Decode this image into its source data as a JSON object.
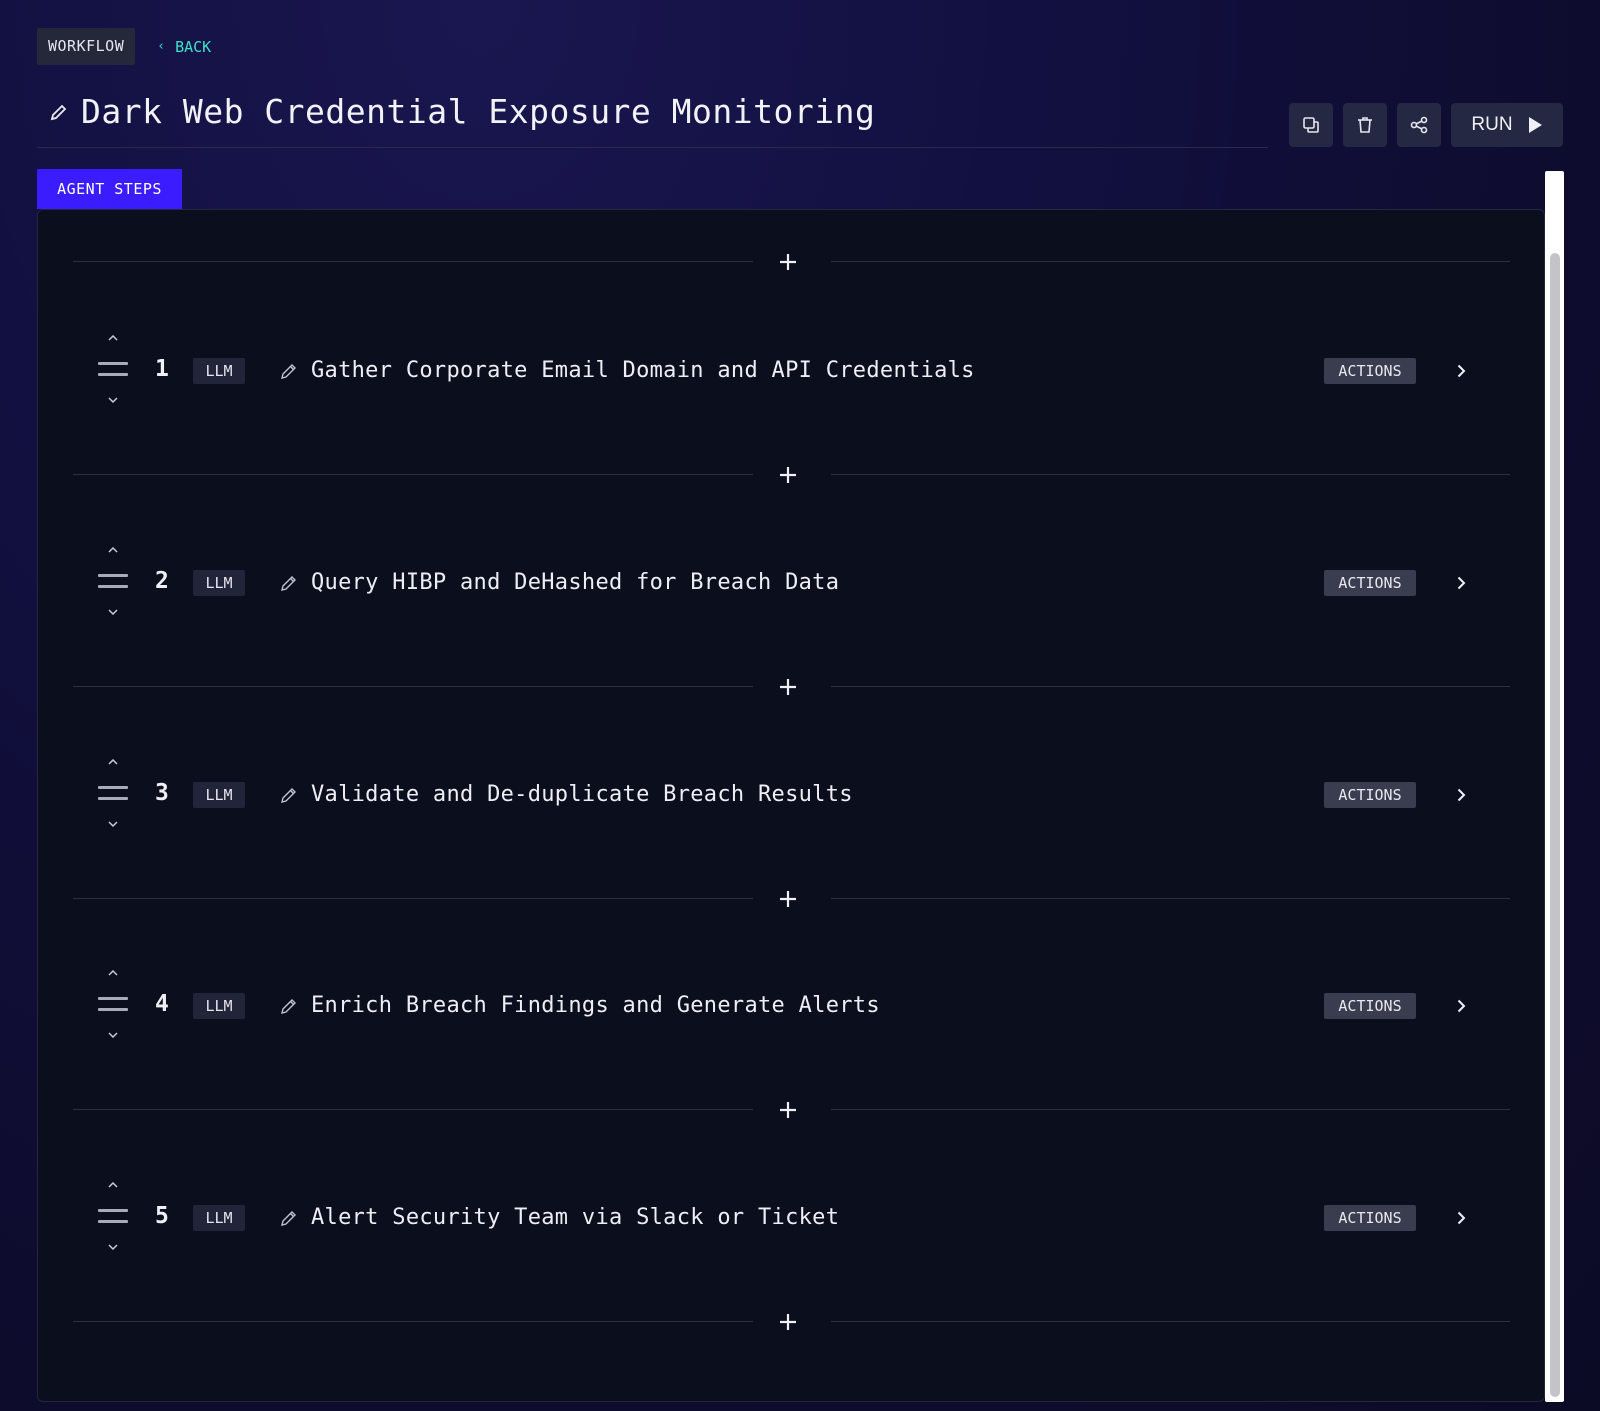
{
  "breadcrumb": {
    "section": "WORKFLOW",
    "back_label": "BACK"
  },
  "page": {
    "title": "Dark Web Credential Exposure Monitoring"
  },
  "toolbar": {
    "duplicate_icon": "copy-icon",
    "delete_icon": "trash-icon",
    "share_icon": "share-icon",
    "run_label": "RUN",
    "run_icon": "play-icon"
  },
  "tabs": {
    "active": "AGENT STEPS"
  },
  "colors": {
    "accent": "#3b1cff",
    "back_link": "#3ee0c8",
    "panel": "#0b0e1c"
  },
  "steps": [
    {
      "number": "1",
      "type": "LLM",
      "title": "Gather Corporate Email Domain and API Credentials",
      "actions_label": "ACTIONS"
    },
    {
      "number": "2",
      "type": "LLM",
      "title": "Query HIBP and DeHashed for Breach Data",
      "actions_label": "ACTIONS"
    },
    {
      "number": "3",
      "type": "LLM",
      "title": "Validate and De-duplicate Breach Results",
      "actions_label": "ACTIONS"
    },
    {
      "number": "4",
      "type": "LLM",
      "title": "Enrich Breach Findings and Generate Alerts",
      "actions_label": "ACTIONS"
    },
    {
      "number": "5",
      "type": "LLM",
      "title": "Alert Security Team via Slack or Ticket",
      "actions_label": "ACTIONS"
    }
  ]
}
